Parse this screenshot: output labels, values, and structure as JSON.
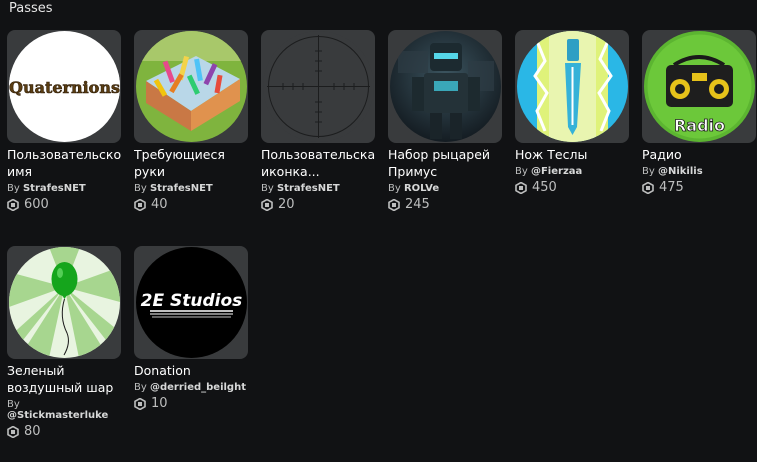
{
  "section": {
    "title": "Passes"
  },
  "passes": [
    {
      "name": "Пользовательское имя",
      "by": "By",
      "creator": "StrafesNET",
      "price": "600",
      "thumb_text": "Quaternions",
      "icon": "quaternions-logo"
    },
    {
      "name": "Требующиеся руки",
      "by": "By",
      "creator": "StrafesNET",
      "price": "40",
      "icon": "many-hands-image"
    },
    {
      "name": "Пользовательская иконка...",
      "by": "By",
      "creator": "StrafesNET",
      "price": "20",
      "icon": "crosshair-icon"
    },
    {
      "name": "Набор рыцарей Примус",
      "by": "By",
      "creator": "ROLVe",
      "price": "245",
      "icon": "knight-armor-image"
    },
    {
      "name": "Нож Теслы",
      "by": "By",
      "creator": "@Fierzaa",
      "price": "450",
      "icon": "tesla-knife-image"
    },
    {
      "name": "Радио",
      "by": "By",
      "creator": "@Nikilis",
      "price": "475",
      "thumb_text": "Radio",
      "icon": "radio-boombox-icon"
    },
    {
      "name": "Зеленый воздушный шар",
      "by": "By",
      "creator": "@Stickmasterluke",
      "price": "80",
      "icon": "green-balloon-icon"
    },
    {
      "name": "Donation",
      "by": "By",
      "creator": "@derried_beilght",
      "price": "10",
      "thumb_text": "2E Studios",
      "icon": "2e-studios-logo"
    }
  ],
  "colors": {
    "background": "#111214",
    "tile": "#393b3d",
    "text": "#ffffff",
    "muted": "#bdbebe"
  }
}
